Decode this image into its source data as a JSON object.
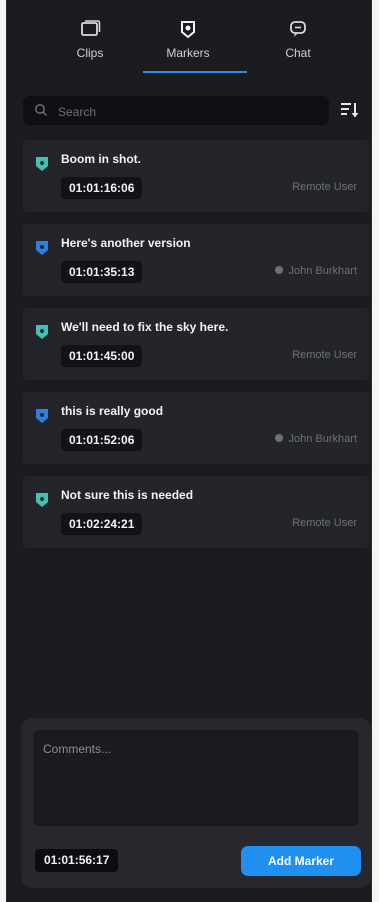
{
  "tabs": [
    {
      "label": "Clips",
      "icon": "clips-icon"
    },
    {
      "label": "Markers",
      "icon": "marker-icon"
    },
    {
      "label": "Chat",
      "icon": "chat-icon"
    }
  ],
  "search": {
    "placeholder": "Search"
  },
  "markers": [
    {
      "title": "Boom in shot.",
      "timecode": "01:01:16:06",
      "user": "Remote User",
      "color": "#3fc3b6",
      "online": false
    },
    {
      "title": "Here's another version",
      "timecode": "01:01:35:13",
      "user": "John Burkhart",
      "color": "#2f7fe0",
      "online": true
    },
    {
      "title": "We'll need to fix the sky here.",
      "timecode": "01:01:45:00",
      "user": "Remote User",
      "color": "#3fc3b6",
      "online": false
    },
    {
      "title": "this is really good",
      "timecode": "01:01:52:06",
      "user": "John Burkhart",
      "color": "#2f7fe0",
      "online": true
    },
    {
      "title": "Not sure this is needed",
      "timecode": "01:02:24:21",
      "user": "Remote User",
      "color": "#3fc3b6",
      "online": false
    }
  ],
  "composer": {
    "placeholder": "Comments...",
    "current_timecode": "01:01:56:17",
    "add_label": "Add Marker"
  },
  "colors": {
    "accent": "#1f8ff0",
    "background": "#1b1c20"
  }
}
